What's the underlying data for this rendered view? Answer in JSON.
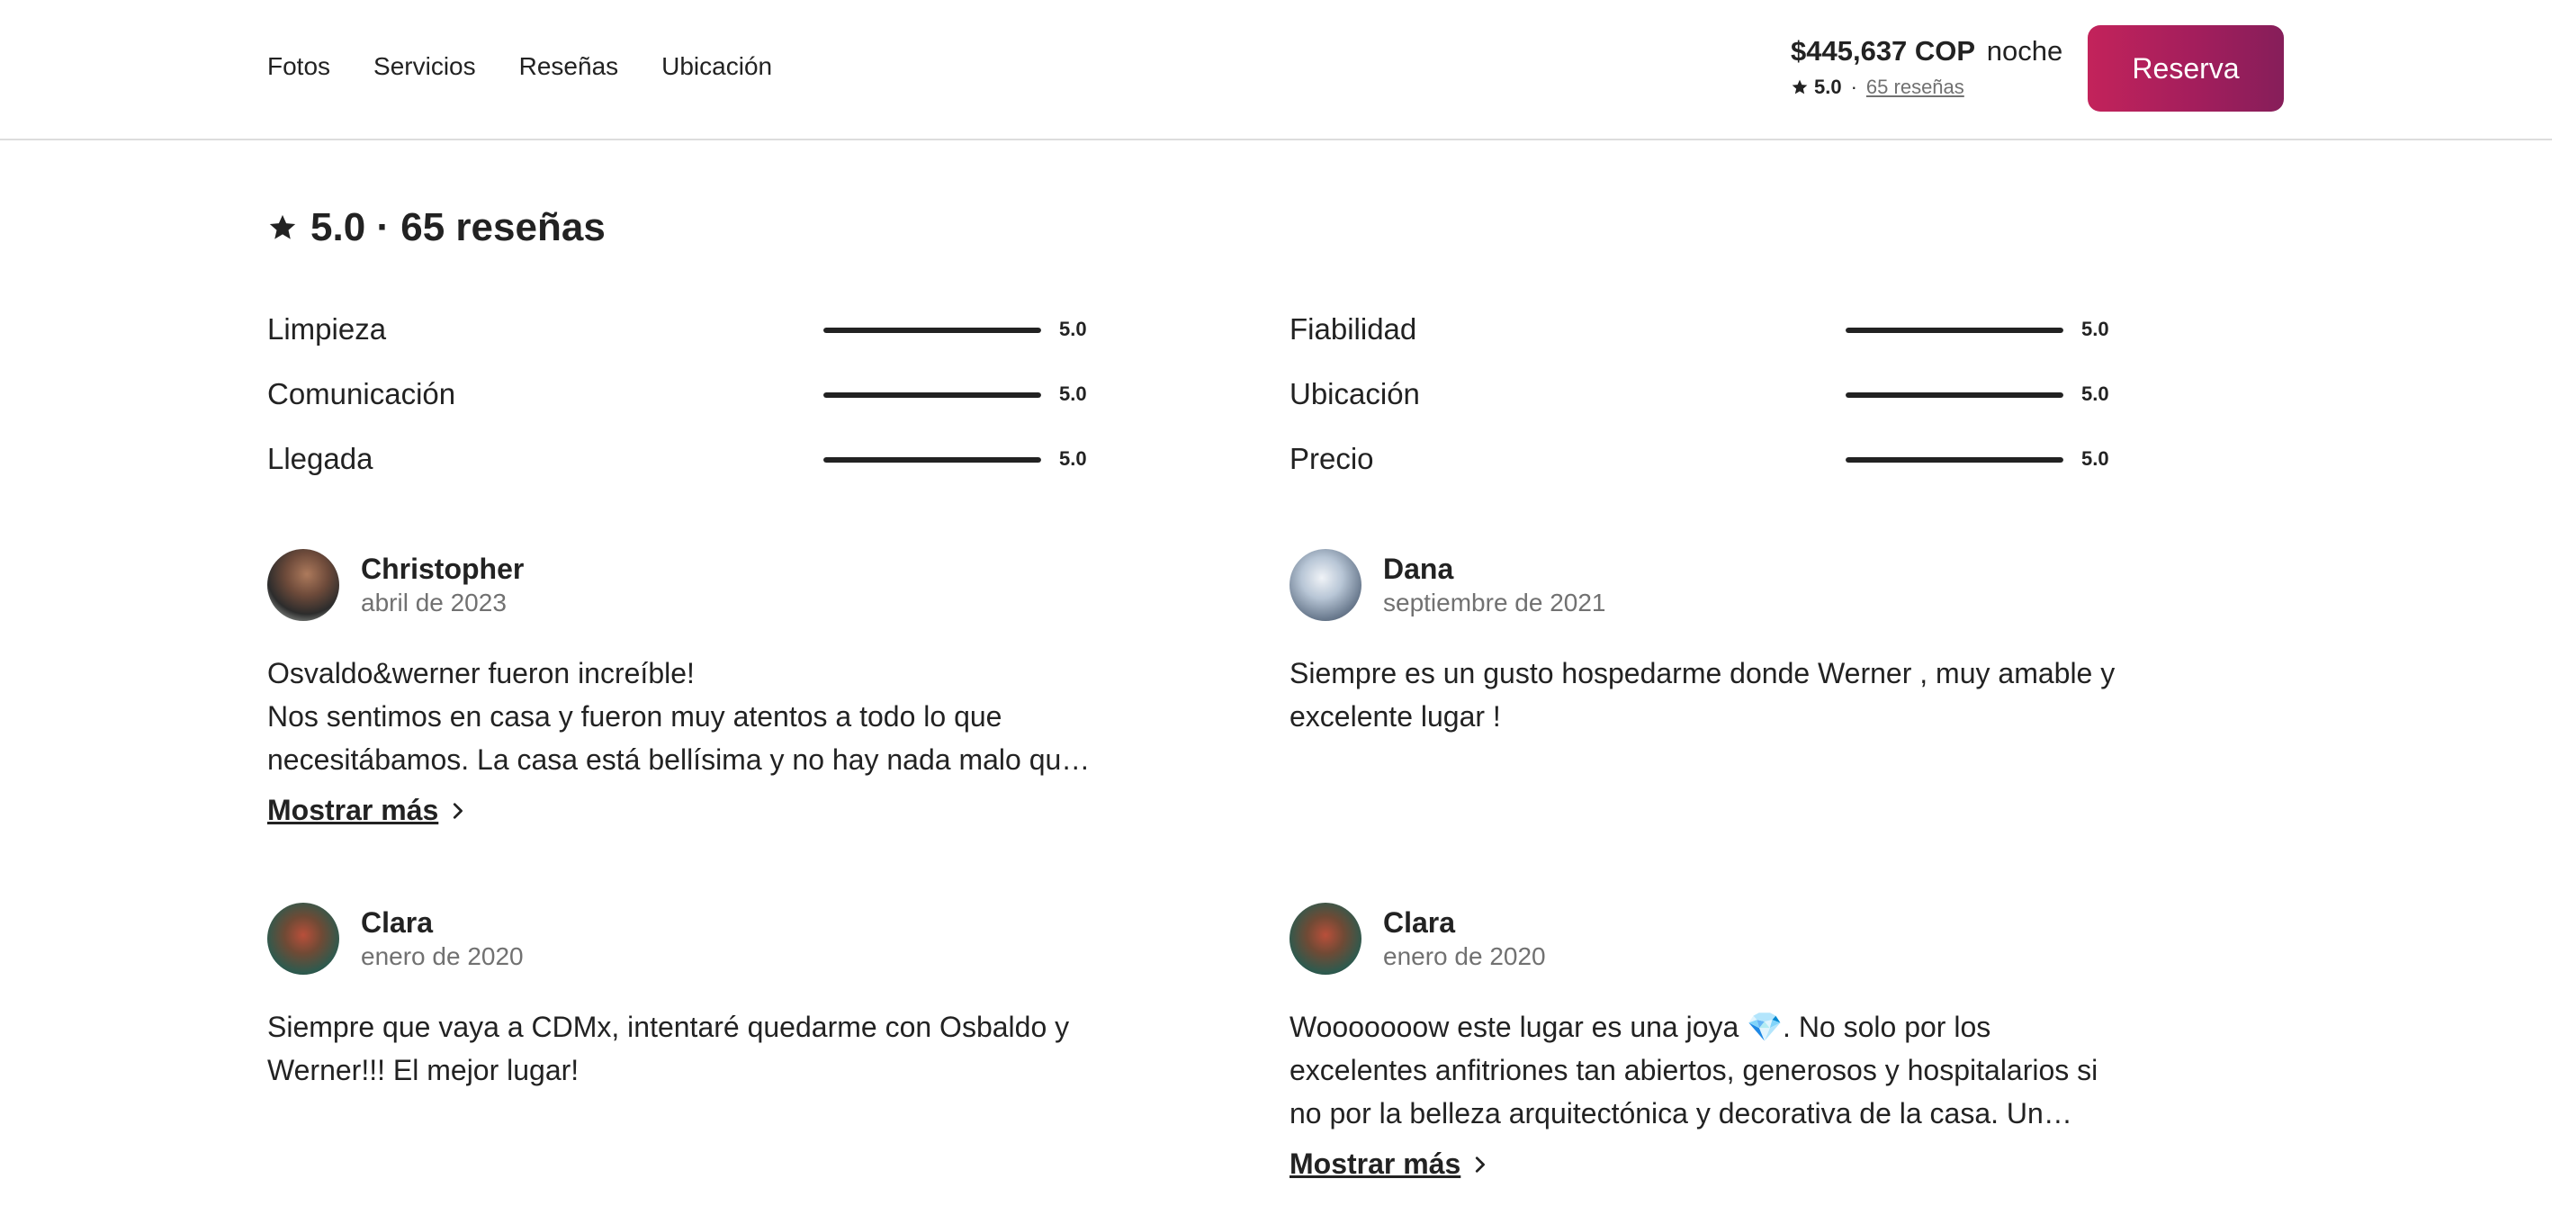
{
  "nav": {
    "items": [
      "Fotos",
      "Servicios",
      "Reseñas",
      "Ubicación"
    ]
  },
  "header": {
    "price": "$445,637 COP",
    "price_unit": "noche",
    "rating": "5.0",
    "reviews_link": "65 reseñas",
    "reserve_label": "Reserva"
  },
  "summary": {
    "heading": "5.0 · 65 reseñas"
  },
  "categories": [
    {
      "label": "Limpieza",
      "value": "5.0",
      "fill": 1.0
    },
    {
      "label": "Fiabilidad",
      "value": "5.0",
      "fill": 1.0
    },
    {
      "label": "Comunicación",
      "value": "5.0",
      "fill": 1.0
    },
    {
      "label": "Ubicación",
      "value": "5.0",
      "fill": 1.0
    },
    {
      "label": "Llegada",
      "value": "5.0",
      "fill": 1.0
    },
    {
      "label": "Precio",
      "value": "5.0",
      "fill": 1.0
    }
  ],
  "reviews": [
    {
      "name": "Christopher",
      "date": "abril de 2023",
      "text": "Osvaldo&werner fueron increíble!\nNos sentimos en casa y fueron muy atentos a todo lo que necesitábamos. La casa está bellísima y no hay nada malo qu…",
      "more": "Mostrar más"
    },
    {
      "name": "Dana",
      "date": "septiembre de 2021",
      "text": "Siempre es un gusto hospedarme donde Werner , muy amable y excelente lugar !"
    },
    {
      "name": "Clara",
      "date": "enero de 2020",
      "text": "Siempre que vaya a CDMx, intentaré quedarme con Osbaldo y Werner!!! El mejor lugar!"
    },
    {
      "name": "Clara",
      "date": "enero de 2020",
      "text": "Wooooooow este lugar es una joya 💎. No solo por los excelentes anfitriones tan abiertos, generosos y hospitalarios si no por la belleza arquitectónica y decorativa de la casa. Un…",
      "more": "Mostrar más"
    }
  ],
  "icons": {
    "star": "star-icon",
    "chevron": "chevron-right-icon"
  }
}
